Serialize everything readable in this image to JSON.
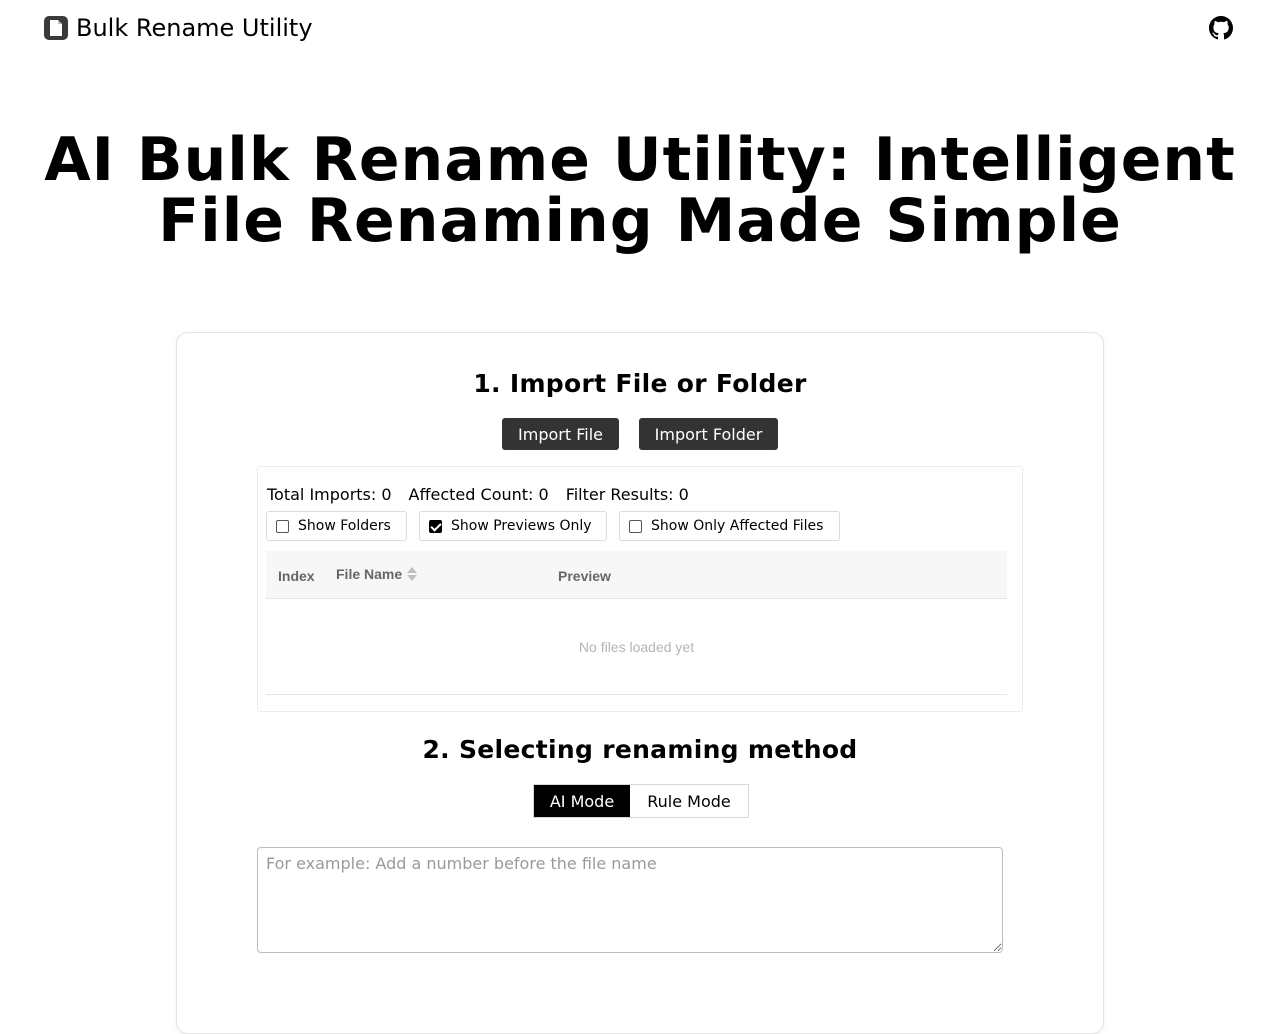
{
  "header": {
    "app_name": "Bulk Rename Utility",
    "logo_icon": "document-icon",
    "github_icon": "github-icon"
  },
  "hero": {
    "title": "AI Bulk Rename Utility: Intelligent File Renaming Made Simple"
  },
  "import_section": {
    "title": "1. Import File or Folder",
    "import_file_label": "Import File",
    "import_folder_label": "Import Folder",
    "stats": {
      "total_imports": "Total Imports: 0",
      "affected_count": "Affected Count: 0",
      "filter_results": "Filter Results: 0"
    },
    "filters": [
      {
        "label": "Show Folders",
        "checked": false
      },
      {
        "label": "Show Previews Only",
        "checked": true
      },
      {
        "label": "Show Only Affected Files",
        "checked": false
      }
    ],
    "table": {
      "columns": [
        "Index",
        "File Name",
        "Preview"
      ],
      "sort_icon": "sort-icon",
      "empty_text": "No files loaded yet"
    }
  },
  "method_section": {
    "title": "2. Selecting renaming method",
    "modes": [
      {
        "label": "AI Mode",
        "active": true
      },
      {
        "label": "Rule Mode",
        "active": false
      }
    ],
    "prompt": {
      "value": "",
      "placeholder": "For example: Add a number before the file name"
    }
  },
  "colors": {
    "dark_button": "#333333",
    "active_mode": "#000000",
    "border": "#e3e3e3",
    "placeholder": "#9a9a9a"
  }
}
